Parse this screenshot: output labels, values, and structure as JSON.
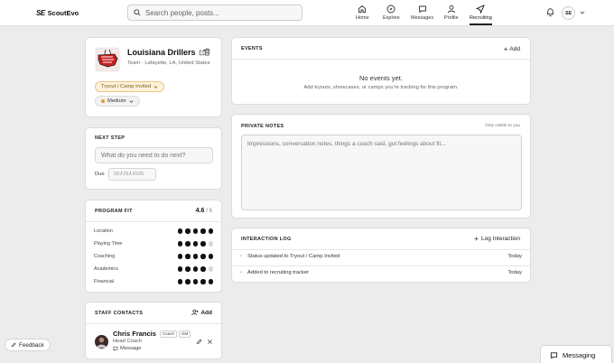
{
  "brand": {
    "name": "ScoutEvo",
    "mark": "SE"
  },
  "search": {
    "placeholder": "Search people, posts..."
  },
  "nav": [
    {
      "label": "Home",
      "icon": "home-icon"
    },
    {
      "label": "Explore",
      "icon": "compass-icon"
    },
    {
      "label": "Messages",
      "icon": "messages-icon"
    },
    {
      "label": "Profile",
      "icon": "user-icon"
    },
    {
      "label": "Recruiting",
      "icon": "send-icon",
      "active": true
    }
  ],
  "user": {
    "initials": "SE"
  },
  "team": {
    "name": "Louisiana Drillers",
    "subtitle": "Team · Lafayette, LA, United States",
    "status": "Tryout / Camp Invited",
    "priority": "Medium"
  },
  "next_step": {
    "title": "NEXT STEP",
    "placeholder": "What do you need to do next?",
    "due_label": "Due",
    "date": {
      "mm": "05",
      "dd": "29",
      "yyyy": "2026"
    }
  },
  "program_fit": {
    "title": "PROGRAM FIT",
    "score": "4.6",
    "out_of": "/ 5",
    "rows": [
      {
        "label": "Location",
        "filled": 5
      },
      {
        "label": "Playing Time",
        "filled": 4
      },
      {
        "label": "Coaching",
        "filled": 5
      },
      {
        "label": "Academics",
        "filled": 4
      },
      {
        "label": "Financial",
        "filled": 5
      }
    ]
  },
  "staff": {
    "title": "STAFF CONTACTS",
    "add_label": "Add",
    "contacts": [
      {
        "name": "Chris Francis",
        "tags": [
          "Coach",
          "GM"
        ],
        "role": "Head Coach",
        "message_label": "Message"
      }
    ]
  },
  "events": {
    "title": "EVENTS",
    "add_label": "Add",
    "empty_title": "No events yet.",
    "empty_sub": "Add tryouts, showcases, or camps you're tracking for this program."
  },
  "notes": {
    "title": "PRIVATE NOTES",
    "visibility": "Only visible to you",
    "placeholder": "Impressions, conversation notes, things a coach said, gut feelings about fit..."
  },
  "log": {
    "title": "INTERACTION LOG",
    "add_label": "Log Interaction",
    "entries": [
      {
        "text": "Status updated to Tryout / Camp Invited",
        "when": "Today"
      },
      {
        "text": "Added to recruiting tracker",
        "when": "Today"
      }
    ]
  },
  "feedback": {
    "label": "Feedback"
  },
  "messaging": {
    "label": "Messaging"
  },
  "colors": {
    "status_bg": "#fdf3dc",
    "status_border": "#e8c880",
    "status_dot": "#e0a030",
    "accent": "#111111"
  }
}
